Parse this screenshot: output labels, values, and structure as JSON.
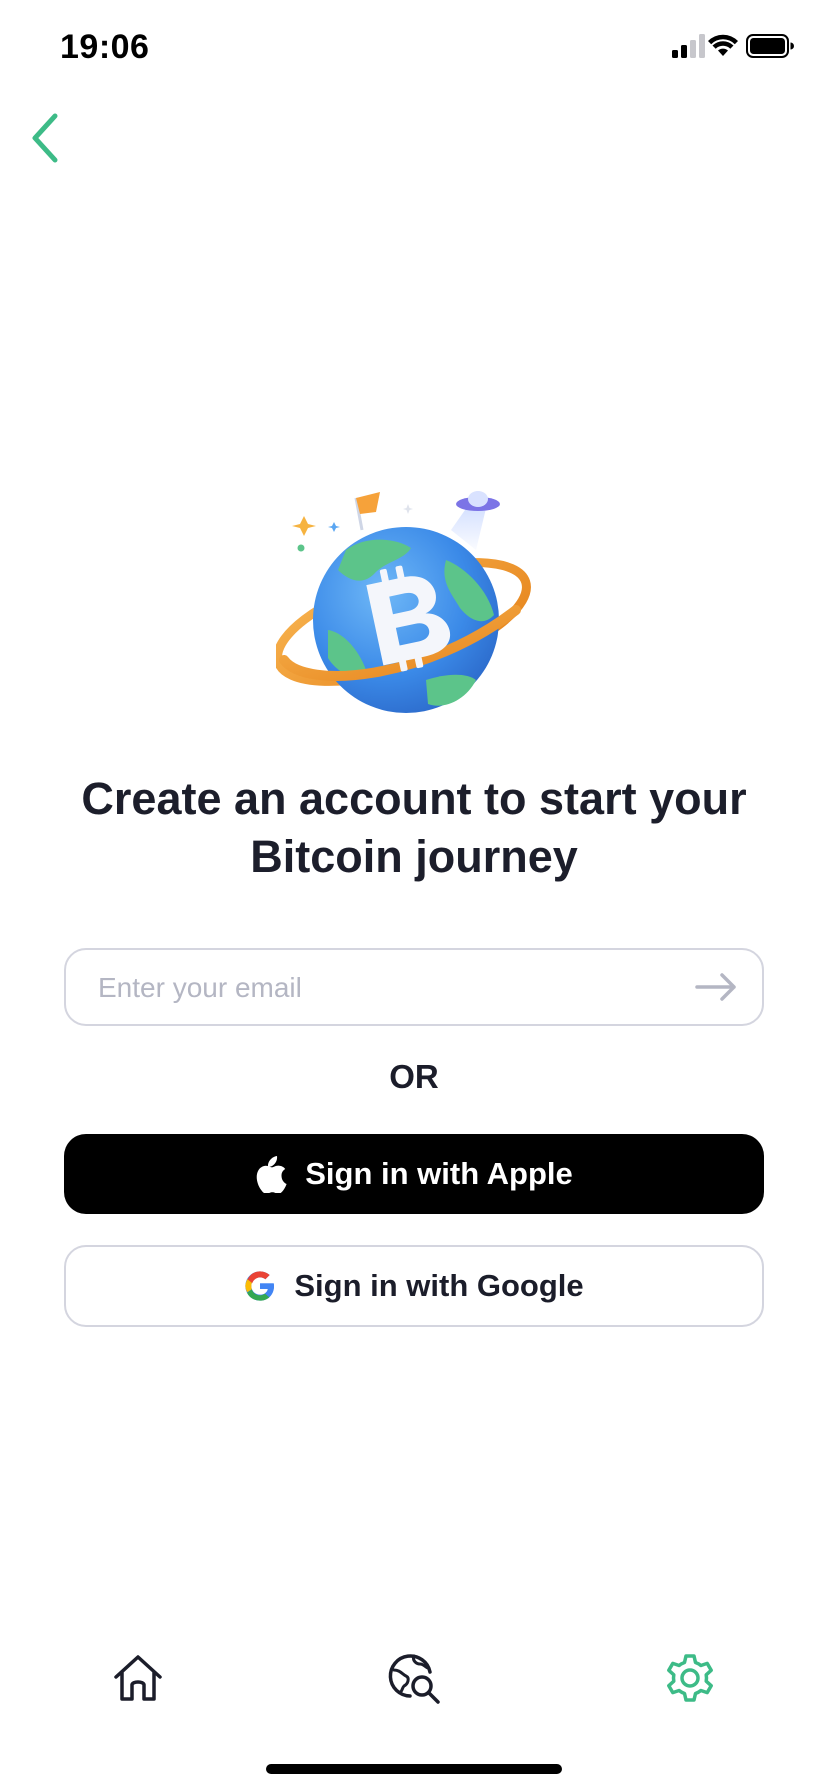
{
  "status_bar": {
    "time": "19:06",
    "icons": [
      "cellular-signal-icon",
      "wifi-icon",
      "battery-icon"
    ]
  },
  "nav": {
    "back_icon": "chevron-left-icon"
  },
  "hero": {
    "illustration": "bitcoin-planet-illustration"
  },
  "headline": {
    "line1": "Create an account to start your",
    "line2": "Bitcoin journey"
  },
  "email": {
    "placeholder": "Enter your email",
    "value": "",
    "submit_icon": "arrow-right-icon"
  },
  "divider_text": "OR",
  "apple_button": {
    "label": "Sign in with Apple",
    "icon": "apple-logo-icon"
  },
  "google_button": {
    "label": "Sign in with Google",
    "icon": "google-logo-icon"
  },
  "tab_bar": {
    "tabs": [
      {
        "icon": "home-icon",
        "active": false
      },
      {
        "icon": "globe-search-icon",
        "active": false
      },
      {
        "icon": "gear-icon",
        "active": true
      }
    ]
  },
  "colors": {
    "accent": "#3dbb87",
    "text_primary": "#1b1d2a",
    "placeholder": "#b4b6c3",
    "border": "#d4d5df",
    "apple_button_bg": "#000000"
  }
}
